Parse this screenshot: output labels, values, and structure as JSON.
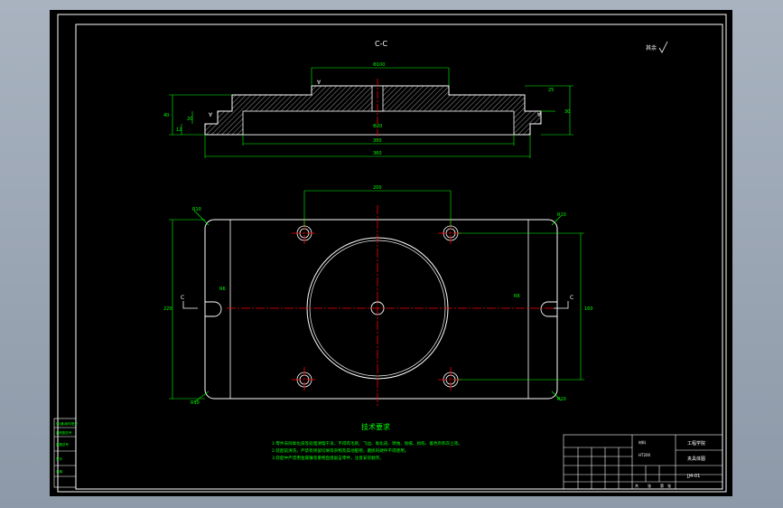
{
  "view_label": "C-C",
  "roughness_note": "其余",
  "tech_title": "技术要求",
  "tech_lines": [
    "1.零件去除氧化皮等处理清理干净，不得有毛刺、飞边、氧化皮、锈蚀、划痕、损伤、着色剂和灰尘等。",
    "2.装配前清洗，严禁有残留切屑等杂物及其他脏物，磨损的硬件不得使用。",
    "3.装配中严禁用金属锤等重物直接敲击零件，注意安装顺序。"
  ],
  "title_block": {
    "material": "HT200",
    "part_name": "夹具体图",
    "school": "工程学院",
    "drawing_no": "JJ4-01",
    "scale_row": [
      "共",
      "张",
      "第",
      "张"
    ]
  },
  "side_stamp": [
    "借(通)用件登记",
    "旧底图总号",
    "底图总号",
    "签字",
    "日期"
  ],
  "dims": {
    "top_width": "Φ100",
    "h1": "40",
    "h2": "12",
    "h3": "20",
    "right_h": "30",
    "right_h2": "25",
    "bore_dim": "Φ20",
    "bottom_dim1": "300",
    "bottom_dim2": "360",
    "plan_width": "200",
    "plan_height": "160",
    "plan_height_total": "220",
    "corner_r": "R10",
    "slot": "R6",
    "hole_dia": "4×Φ12"
  },
  "section_marks": [
    "C",
    "C"
  ]
}
